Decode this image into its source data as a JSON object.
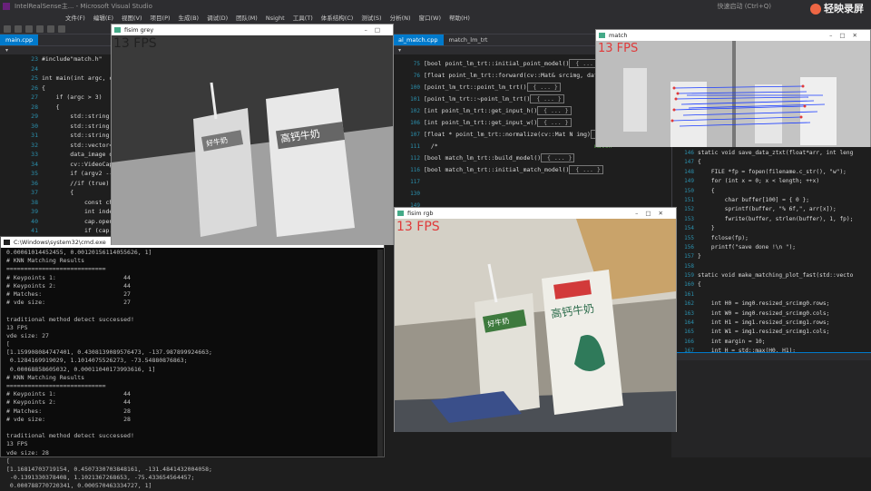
{
  "vs": {
    "title": "IntelRealSense主... - Microsoft Visual Studio",
    "right_title": "快速启动 (Ctrl+Q)",
    "watermark": "轻映录屏",
    "menu": [
      "文件(F)",
      "编辑(E)",
      "视图(V)",
      "项目(P)",
      "生成(B)",
      "调试(D)",
      "团队(M)",
      "Nsight",
      "工具(T)",
      "体系结构(C)",
      "测试(S)",
      "分析(N)",
      "窗口(W)",
      "帮助(H)"
    ]
  },
  "editor_left": {
    "tab": "main.cpp",
    "lines": [
      "23",
      "24",
      "25",
      "26",
      "27",
      "28",
      "29",
      "30",
      "31",
      "32",
      "33",
      "34",
      "35",
      "36",
      "37",
      "38",
      "39",
      "40",
      "41",
      "42",
      "43",
      "44",
      "45"
    ],
    "code": [
      "#include\"match.h\"",
      "",
      "int main(int argc, ch",
      "{",
      "    if (argc > 3)",
      "    {",
      "        std::string a",
      "        std::string u",
      "        std::string u",
      "        std::vector<",
      "        data_image di",
      "        cv::VideoCapt",
      "        if (argv2 --",
      "        //if (true)",
      "        {",
      "            const cha",
      "            int index",
      "            cap.open(",
      "            if (cap.i",
      "            {",
      "                bool",
      "                if (l",
      "                {"
    ]
  },
  "editor_center": {
    "tab1": "al_match.cpp",
    "tab2": "match_lm_trt",
    "lines": [
      "75",
      "76",
      "100",
      "101",
      "102",
      "106",
      "107",
      "111",
      "112",
      "116",
      "117",
      "130",
      "149",
      "197"
    ],
    "code": [
      "[bool point_lm_trt::initial_point_model()",
      "[float point_lm_trt::forward(cv::Mat& srcimg, data",
      "[point_lm_trt::point_lm_trt()",
      "[point_lm_trt::~point_lm_trt()",
      "[int point_lm_trt::get_input_h()",
      "[int point_lm_trt::get_input_w()",
      "[float * point_lm_trt::normalize(cv::Mat N img)",
      "  /*",
      "[bool match_lm_trt::build_model()",
      "[bool match_lm_trt::initial_match_model()"
    ],
    "collapsed": "{ ... }",
    "comment": "match"
  },
  "editor_right": {
    "lines": [
      "146",
      "147",
      "148",
      "149",
      "150",
      "151",
      "152",
      "153",
      "154",
      "155",
      "156",
      "157",
      "158",
      "159",
      "160",
      "161",
      "162",
      "163",
      "164",
      "165",
      "166",
      "167",
      "168"
    ],
    "code": [
      "static void save_data_ztxt(float*arr, int leng",
      "{",
      "    FILE *fp = fopen(filename.c_str(), \"w\");",
      "    for (int x = 0; x < length; ++x)",
      "    {",
      "        char buffer[100] = { 0 };",
      "        sprintf(buffer, \"% 6f,\", arr[x]);",
      "        fwrite(buffer, strlen(buffer), 1, fp);",
      "    }",
      "    fclose(fp);",
      "    printf(\"save done !\\n \");",
      "}",
      "",
      "static void make_matching_plot_fast(std::vecto",
      "{",
      "",
      "    int H0 = img0.resized_srcimg0.rows;",
      "    int W0 = img0.resized_srcimg0.cols;",
      "    int H1 = img1.resized_srcimg1.rows;",
      "    int W1 = img1.resized_srcimg1.cols;",
      "    int margin = 10;",
      "    int H = std::max(H0, H1);",
      "    int W   W0 + W1 + margin;"
    ]
  },
  "console": {
    "title": "C:\\Windows\\system32\\cmd.exe",
    "lines": [
      "0.00061014452455, 0.00120156114055626, 1]",
      "# KNN Matching Results",
      "============================",
      "# Keypoints 1:                   44",
      "# Keypoints 2:                   44",
      "# Matches:                       27",
      "# vde size:                      27",
      "",
      "traditional method detect successed!",
      "13 FPS",
      "vde size: 27",
      "[",
      "[1.159908084747401, 0.4308139089576473, -137.987899924663;",
      " 0.1284169919029, 1.1014075526273, -73.54880876863;",
      " 0.00068858605032, 0.00011040173993616, 1]",
      "# KNN Matching Results",
      "============================",
      "# Keypoints 1:                   44",
      "# Keypoints 2:                   44",
      "# Matches:                       28",
      "# vde size:                      28",
      "",
      "traditional method detect successed!",
      "13 FPS",
      "vde size: 28",
      "[",
      "[1.16814703719154, 0.4507330703848161, -131.4841432004058;",
      " -0.1391330378408, 1.1021367268653, -75.433654564457;",
      " 0.000788770720341, 0.000570463334727, 1]"
    ]
  },
  "grey_window": {
    "title": "fisim grey",
    "fps": "13 FPS"
  },
  "color_window": {
    "title": "fisim rgb",
    "fps": "13 FPS"
  },
  "match_window": {
    "title": "match",
    "fps": "13 FPS"
  },
  "product": {
    "brand": "高钙牛奶",
    "logo": "好牛奶"
  },
  "colors": {
    "fps_text": "#e03a3a",
    "vs_accent": "#007acc",
    "match_line": "#1a3cff"
  }
}
